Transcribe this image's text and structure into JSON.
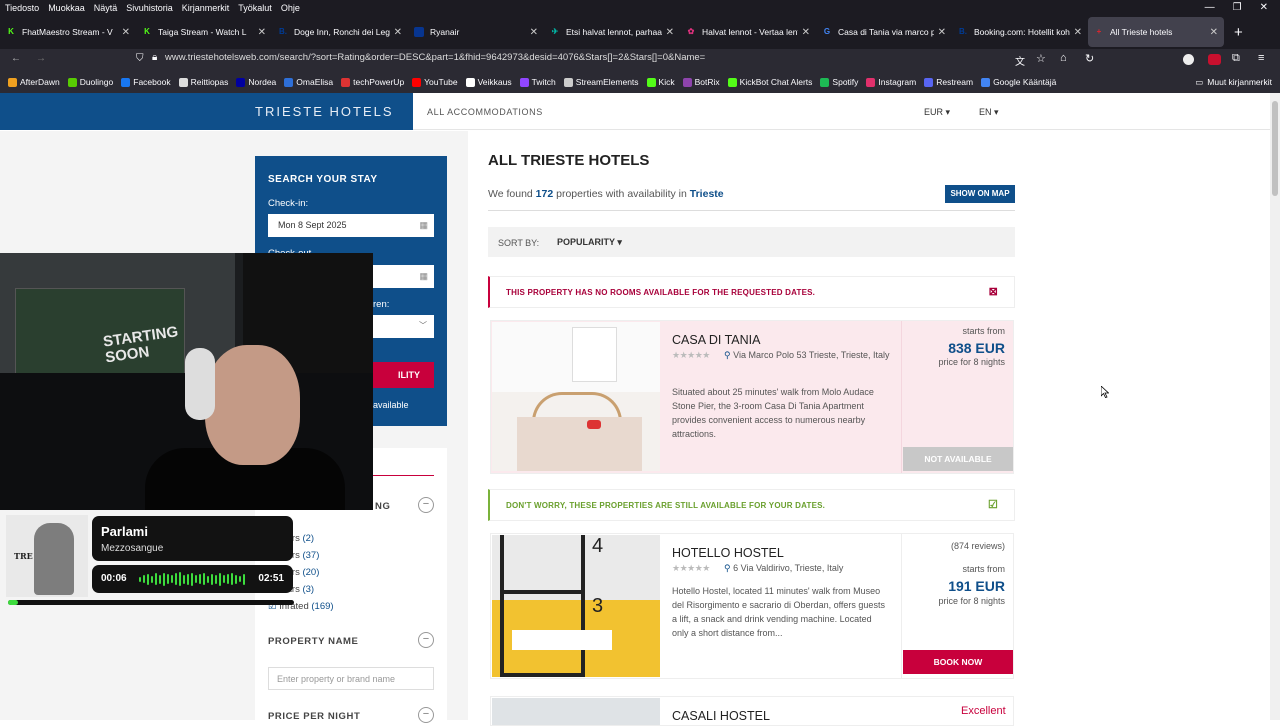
{
  "menubar": [
    "Tiedosto",
    "Muokkaa",
    "Näytä",
    "Sivuhistoria",
    "Kirjanmerkit",
    "Työkalut",
    "Ohje"
  ],
  "tabs": [
    {
      "title": "FhatMaestro Stream - V",
      "color": "#53fc18",
      "glyph": "K"
    },
    {
      "title": "Taiga Stream - Watch L",
      "color": "#53fc18",
      "glyph": "K"
    },
    {
      "title": "Doge Inn, Ronchi dei Legion",
      "color": "#003b95",
      "glyph": "B."
    },
    {
      "title": "Ryanair",
      "color": "#073590",
      "glyph": ""
    },
    {
      "title": "Etsi halvat lennot, parhaat h",
      "color": "#00b9a8",
      "glyph": "✈"
    },
    {
      "title": "Halvat lennot - Vertaa lento",
      "color": "#e0317e",
      "glyph": "✿"
    },
    {
      "title": "Casa di Tania via marco pol",
      "color": "#4285f4",
      "glyph": "G"
    },
    {
      "title": "Booking.com: Hotellit kohte",
      "color": "#003b95",
      "glyph": "B."
    },
    {
      "title": "All Trieste hotels",
      "color": "#e0242d",
      "glyph": "+"
    }
  ],
  "url": "www.triestehotelsweb.com/search/?sort=Rating&order=DESC&part=1&fhid=9642973&desid=4076&Stars[]=2&Stars[]=0&Name=",
  "bookmarks": [
    {
      "label": "AfterDawn",
      "color": "#f0a020"
    },
    {
      "label": "Duolingo",
      "color": "#58cc02"
    },
    {
      "label": "Facebook",
      "color": "#1877f2"
    },
    {
      "label": "Reittiopas",
      "color": "#dddddd"
    },
    {
      "label": "Nordea",
      "color": "#0000a0"
    },
    {
      "label": "OmaElisa",
      "color": "#2e6fd8"
    },
    {
      "label": "techPowerUp",
      "color": "#d33"
    },
    {
      "label": "YouTube",
      "color": "#ff0000"
    },
    {
      "label": "Veikkaus",
      "color": "#ffffff"
    },
    {
      "label": "Twitch",
      "color": "#9146ff"
    },
    {
      "label": "StreamElements",
      "color": "#cccccc"
    },
    {
      "label": "Kick",
      "color": "#53fc18"
    },
    {
      "label": "BotRix",
      "color": "#8e44ad"
    },
    {
      "label": "KickBot Chat Alerts",
      "color": "#53fc18"
    },
    {
      "label": "Spotify",
      "color": "#1db954"
    },
    {
      "label": "Instagram",
      "color": "#e1306c"
    },
    {
      "label": "Restream",
      "color": "#5865f2"
    },
    {
      "label": "Google Kääntäjä",
      "color": "#4285f4"
    }
  ],
  "other_bookmarks": "Muut kirjanmerkit",
  "site": {
    "brand": "TRIESTE HOTELS",
    "nav_all": "ALL ACCOMMODATIONS",
    "currency": "EUR ▾",
    "language": "EN ▾"
  },
  "search": {
    "heading": "SEARCH YOUR STAY",
    "checkin_label": "Check-in:",
    "checkin_value": "Mon 8 Sept 2025",
    "checkout_label": "Check-out",
    "children_label": "ren:",
    "button_partial": "ILITY",
    "avail_partial": "available"
  },
  "filters": {
    "rating_head_partial": "NG",
    "rating_rows": [
      {
        "label": "tars",
        "count": "(2)"
      },
      {
        "label": "tars",
        "count": "(37)"
      },
      {
        "label": "tars",
        "count": "(20)"
      },
      {
        "label": "tars",
        "count": "(3)"
      },
      {
        "label": "Inrated",
        "count": "(169)"
      }
    ],
    "property_name_head": "PROPERTY NAME",
    "property_placeholder": "Enter property or brand name",
    "price_head": "PRICE PER NIGHT",
    "toggle": "−"
  },
  "webcam": {
    "poster_text": "STARTING SOON"
  },
  "music": {
    "title": "Parlami",
    "artist": "Mezzosangue",
    "elapsed": "00:06",
    "total": "02:51",
    "progress_pct": 3.5,
    "cover_text": "TRE"
  },
  "main": {
    "title": "ALL TRIESTE HOTELS",
    "found_pre": "We found ",
    "found_count": "172",
    "found_mid": " properties with availability in ",
    "found_city": "Trieste",
    "map_button": "SHOW ON MAP",
    "sort_label": "SORT BY:",
    "sort_value": "POPULARITY ▾",
    "notice_unavailable": "THIS PROPERTY HAS NO ROOMS AVAILABLE FOR THE REQUESTED DATES.",
    "notice_available": "DON'T WORRY, THESE PROPERTIES ARE STILL AVAILABLE FOR YOUR DATES."
  },
  "hotels": [
    {
      "name": "CASA DI TANIA",
      "stars": "★★★★★",
      "address": "Via Marco Polo 53 Trieste, Trieste, Italy",
      "description": "Situated about 25 minutes' walk from Molo Audace Stone Pier, the 3-room Casa Di Tania Apartment provides convenient access to numerous nearby attractions.",
      "starts_from": "starts from",
      "price": "838 EUR",
      "nights": "price for 8 nights",
      "button": "NOT AVAILABLE"
    },
    {
      "name": "HOTELLO HOSTEL",
      "stars": "★★★★★",
      "address": "6 Via Valdirivo, Trieste, Italy",
      "reviews": "(874 reviews)",
      "description": "Hotello Hostel, located 11 minutes' walk from Museo del Risorgimento e sacrario di Oberdan, offers guests a lift, a snack and drink vending machine. Located only a short distance from...",
      "starts_from": "starts from",
      "price": "191 EUR",
      "nights": "price for 8 nights",
      "button": "BOOK NOW",
      "photo_digits": [
        "4",
        "3"
      ]
    },
    {
      "name": "CASALI HOSTEL",
      "rating_word": "Excellent"
    }
  ]
}
